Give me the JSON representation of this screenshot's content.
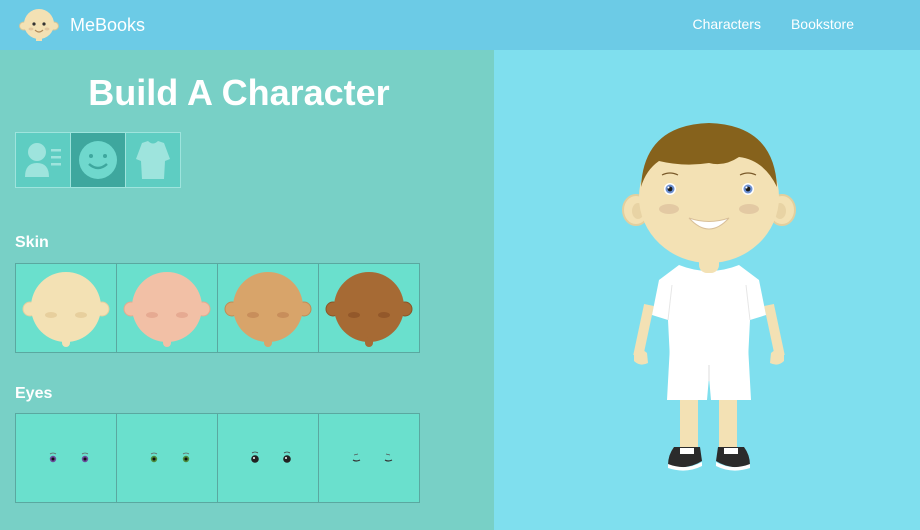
{
  "header": {
    "brand": "MeBooks",
    "nav": [
      "Characters",
      "Bookstore"
    ]
  },
  "builder": {
    "title": "Build A Character",
    "tabs": [
      "profile-icon",
      "face-icon",
      "shirt-icon"
    ],
    "active_tab": 1,
    "skin": {
      "label": "Skin",
      "options": [
        "#f3e1b4",
        "#f2c0a6",
        "#d8a46a",
        "#a66a34"
      ]
    },
    "eyes": {
      "label": "Eyes",
      "options": [
        "purple",
        "green",
        "black",
        "closed"
      ]
    }
  },
  "colors": {
    "header": "#6ccbe6",
    "left_panel": "#78d0c6",
    "right_panel": "#7fdfee",
    "cell": "#6ae0cd",
    "hair": "#86621c",
    "skin_selected": "#f3e1b4"
  }
}
